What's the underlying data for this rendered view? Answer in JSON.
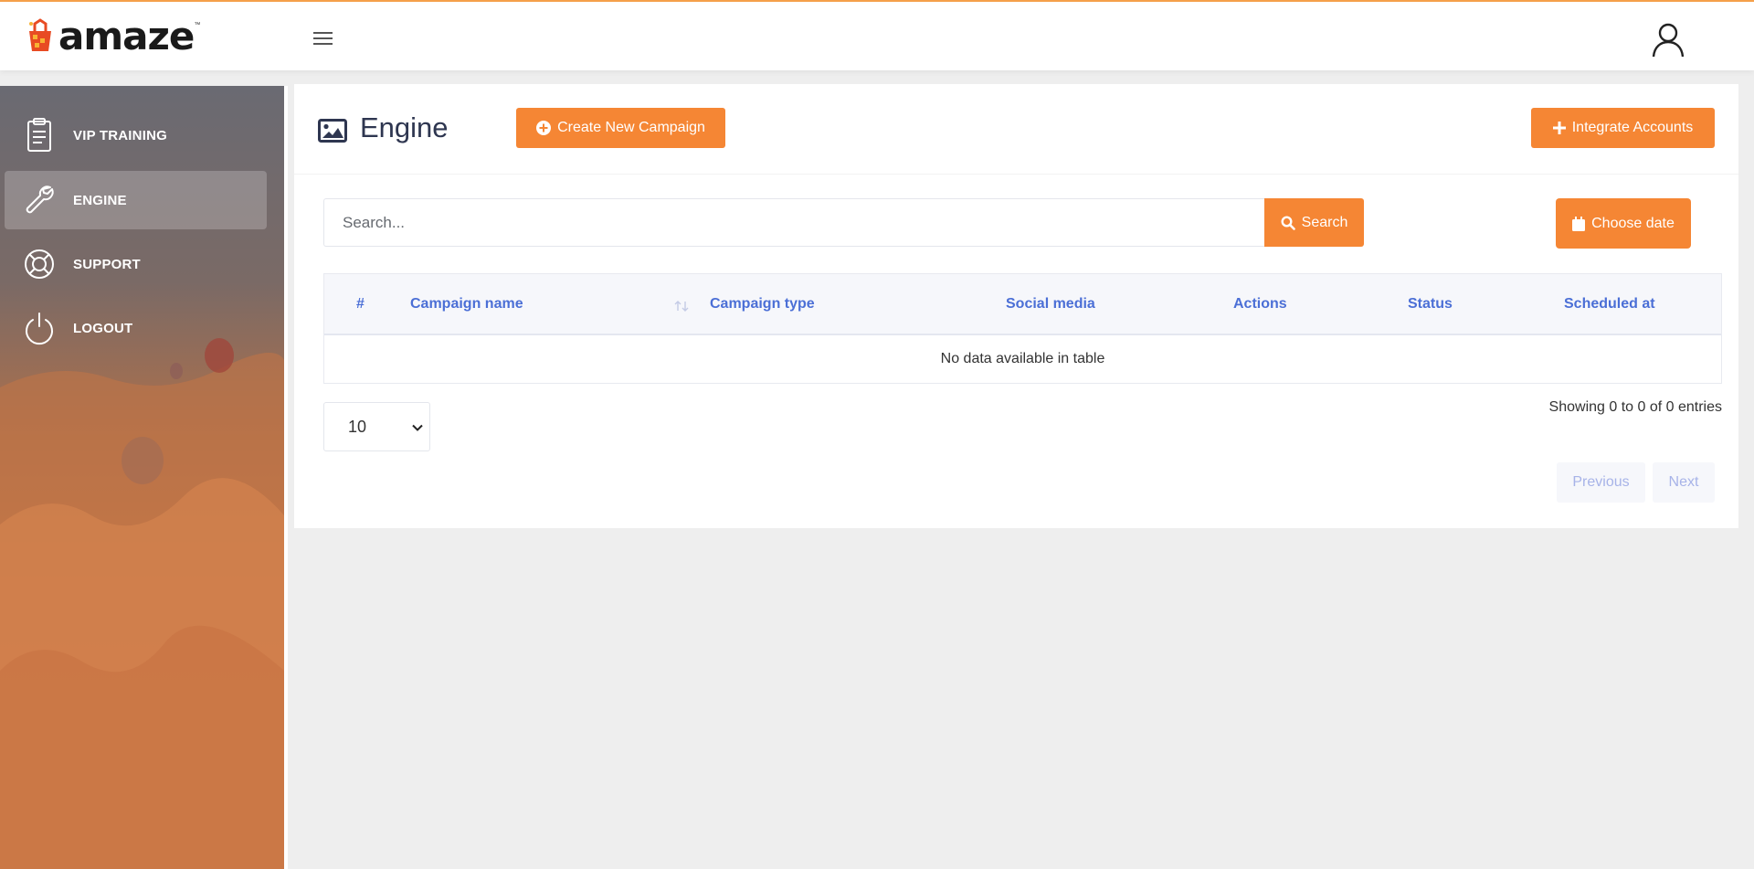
{
  "brand": {
    "name": "amaze",
    "trademark": "™"
  },
  "header": {
    "menu_icon": "hamburger-icon",
    "user_icon": "user-icon"
  },
  "sidebar": {
    "items": [
      {
        "label": "VIP TRAINING",
        "icon": "clipboard-icon",
        "active": false
      },
      {
        "label": "ENGINE",
        "icon": "wrench-icon",
        "active": true
      },
      {
        "label": "SUPPORT",
        "icon": "lifebuoy-icon",
        "active": false
      },
      {
        "label": "LOGOUT",
        "icon": "power-icon",
        "active": false
      }
    ]
  },
  "page": {
    "title": "Engine",
    "title_icon": "image-icon",
    "create_button": "Create New Campaign",
    "integrate_button": "Integrate Accounts"
  },
  "search": {
    "placeholder": "Search...",
    "value": "",
    "button_label": "Search",
    "date_button": "Choose date"
  },
  "table": {
    "columns": [
      "#",
      "Campaign name",
      "Campaign type",
      "Social media",
      "Actions",
      "Status",
      "Scheduled at"
    ],
    "empty_message": "No data available in table",
    "rows": []
  },
  "pagination": {
    "page_size": "10",
    "info": "Showing 0 to 0 of 0 entries",
    "previous": "Previous",
    "next": "Next"
  },
  "colors": {
    "accent": "#f58634",
    "header_text": "#4b6fd6",
    "title": "#2e3650"
  }
}
